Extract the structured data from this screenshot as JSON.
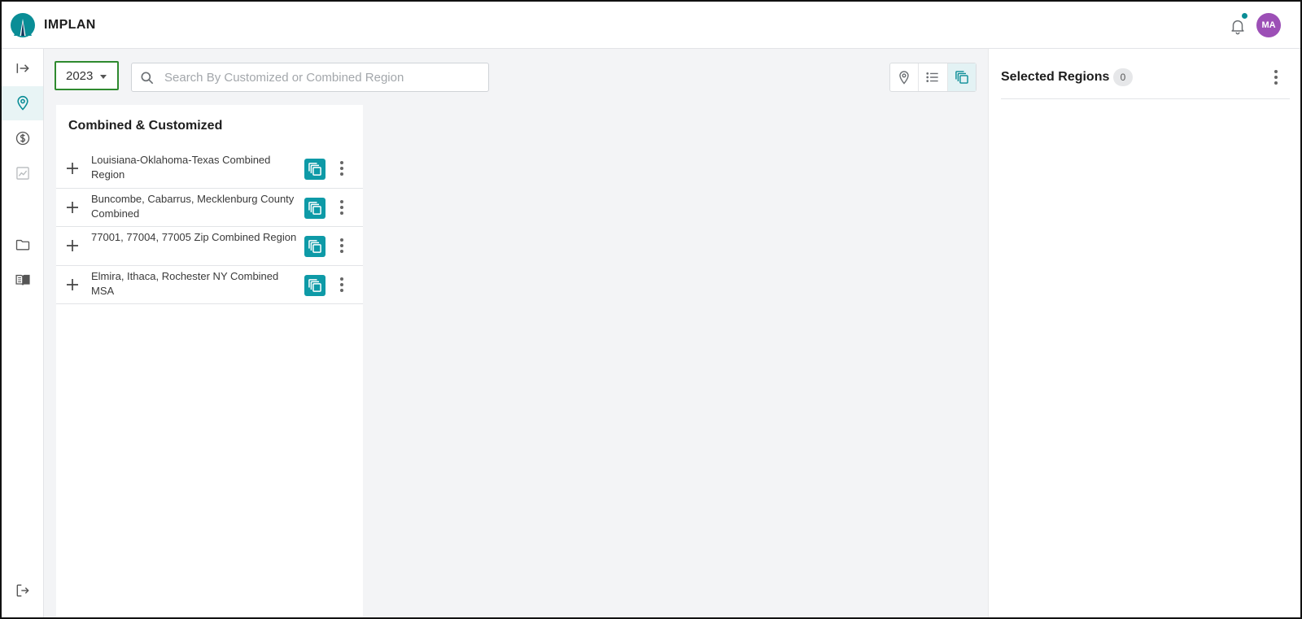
{
  "app": {
    "brand": "IMPLAN"
  },
  "header": {
    "user_initials": "MA",
    "notification_indicator": true,
    "colors": {
      "avatar": "#9c4fb6",
      "accent": "#0a8d96"
    }
  },
  "sidebar": {
    "items": [
      {
        "name": "expand",
        "icon": "arrow-right-bar-icon"
      },
      {
        "name": "regions",
        "icon": "map-pin-icon",
        "active": true
      },
      {
        "name": "economics",
        "icon": "dollar-circle-icon"
      },
      {
        "name": "analytics",
        "icon": "chart-line-icon",
        "disabled": true
      },
      {
        "name": "projects",
        "icon": "folder-icon"
      },
      {
        "name": "library",
        "icon": "book-icon"
      },
      {
        "name": "logout",
        "icon": "logout-icon"
      }
    ]
  },
  "toolbar": {
    "year": "2023",
    "search_placeholder": "Search By Customized or Combined Region",
    "search_value": "",
    "view_modes": [
      "map-view-icon",
      "list-view-icon",
      "combined-view-icon"
    ],
    "active_view": "combined-view-icon"
  },
  "panel": {
    "title": "Combined & Customized",
    "regions": [
      {
        "name": "Louisiana-Oklahoma-Texas Combined Region"
      },
      {
        "name": "Buncombe, Cabarrus, Mecklenburg County Combined"
      },
      {
        "name": "77001, 77004, 77005 Zip Combined Region"
      },
      {
        "name": "Elmira, Ithaca, Rochester NY Combined MSA"
      }
    ]
  },
  "selected": {
    "title": "Selected Regions",
    "count": "0"
  }
}
